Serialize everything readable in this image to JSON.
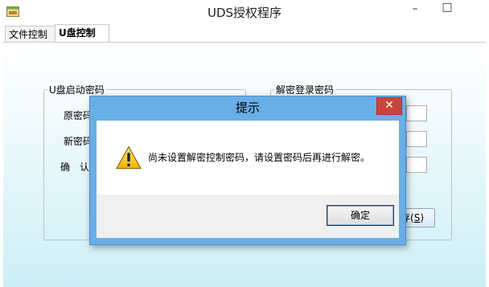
{
  "window": {
    "title": "UDS授权程序",
    "minimize": "–",
    "maximize": "□",
    "close": "✕"
  },
  "tabs": [
    {
      "label": "文件控制"
    },
    {
      "label": "U盘控制"
    }
  ],
  "usb_group": {
    "legend": "U盘启动密码",
    "labels": {
      "old": "原密码",
      "new": "新密码",
      "confirm": "确　认"
    }
  },
  "decrypt_group": {
    "legend": "解密登录密码"
  },
  "save_button": {
    "label_visible": "存(",
    "mnemonic": "S",
    "label_tail": ")"
  },
  "dialog": {
    "title": "提示",
    "close": "✕",
    "message": "尚未设置解密控制密码，请设置密码后再进行解密。",
    "ok": "确定",
    "icon": "warning-icon"
  },
  "colors": {
    "dialog_frame": "#6aaee8",
    "close_red": "#c7463b",
    "panel_gradient_bottom": "#cceff6"
  }
}
